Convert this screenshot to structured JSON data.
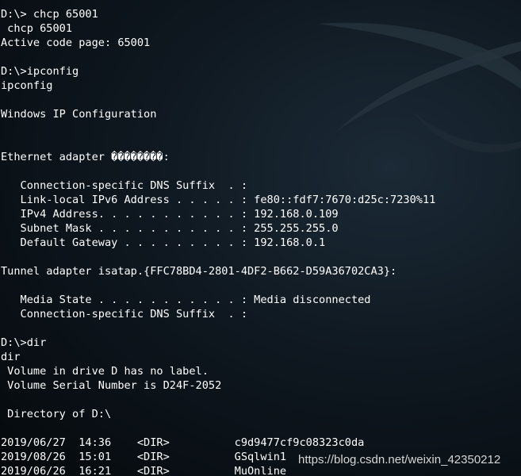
{
  "terminal": {
    "lines": [
      "D:\\> chcp 65001",
      " chcp 65001",
      "Active code page: 65001",
      "",
      "D:\\>ipconfig",
      "ipconfig",
      "",
      "Windows IP Configuration",
      "",
      "",
      "Ethernet adapter ��������:",
      "",
      "   Connection-specific DNS Suffix  . :",
      "   Link-local IPv6 Address . . . . . : fe80::fdf7:7670:d25c:7230%11",
      "   IPv4 Address. . . . . . . . . . . : 192.168.0.109",
      "   Subnet Mask . . . . . . . . . . . : 255.255.255.0",
      "   Default Gateway . . . . . . . . . : 192.168.0.1",
      "",
      "Tunnel adapter isatap.{FFC78BD4-2801-4DF2-B662-D59A36702CA3}:",
      "",
      "   Media State . . . . . . . . . . . : Media disconnected",
      "   Connection-specific DNS Suffix  . :",
      "",
      "D:\\>dir",
      "dir",
      " Volume in drive D has no label.",
      " Volume Serial Number is D24F-2052",
      "",
      " Directory of D:\\",
      "",
      "2019/06/27  14:36    <DIR>          c9d9477cf9c08323c0da",
      "2019/08/26  15:01    <DIR>          GSqlwin1",
      "2019/06/26  16:21    <DIR>          MuOnline"
    ]
  },
  "watermark": "https://blog.csdn.net/weixin_42350212"
}
